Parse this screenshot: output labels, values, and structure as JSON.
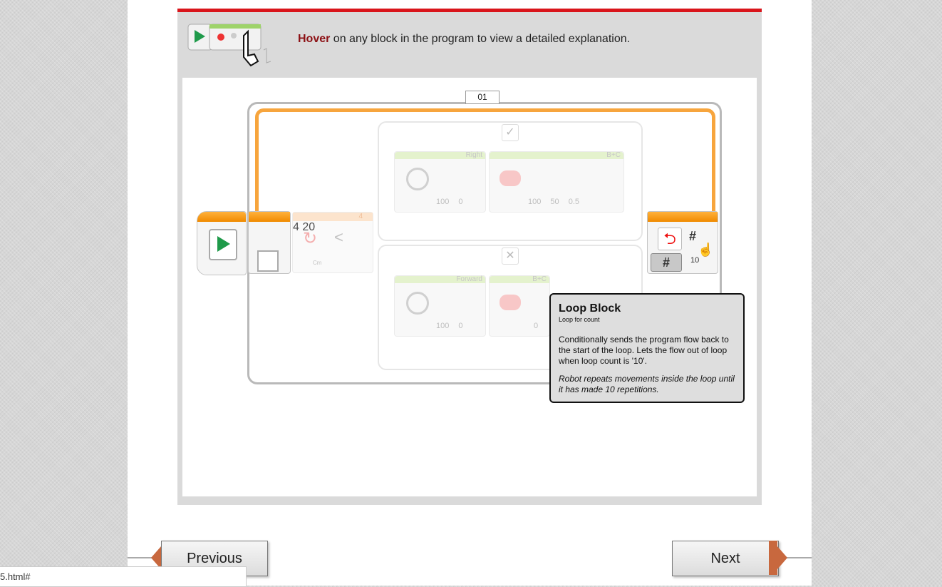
{
  "hint": {
    "bold": "Hover",
    "text": " on any block in the program to view a detailed explanation."
  },
  "loop": {
    "label": "01",
    "count": "10",
    "hash": "#"
  },
  "blocks": {
    "right_name": "Right",
    "right_nums": "100 0",
    "motor_top_name": "B+C",
    "motor_top_nums": "100 50 0.5",
    "forward_name": "Forward",
    "forward_nums": "100 0",
    "motor_bottom_name": "B+C",
    "motor_bottom_nums": "0",
    "compare_top": "4",
    "compare_nums": "4 20",
    "compare_unit": "Cm",
    "true_mark": "✓",
    "false_mark": "✕"
  },
  "tooltip": {
    "title": "Loop Block",
    "subtitle": "Loop for count",
    "description": "Conditionally sends the program flow back to the start of the loop. Lets the flow out of loop when loop count is '10'.",
    "example": "Robot repeats movements inside the loop until it has made 10 repetitions."
  },
  "nav": {
    "previous": "Previous",
    "next": "Next"
  },
  "status_url": "5.html#",
  "colors": {
    "accent_red": "#d9151b",
    "hover_word": "#8c1014",
    "orange": "#f7a53d",
    "nav_tab": "#c8683e"
  }
}
